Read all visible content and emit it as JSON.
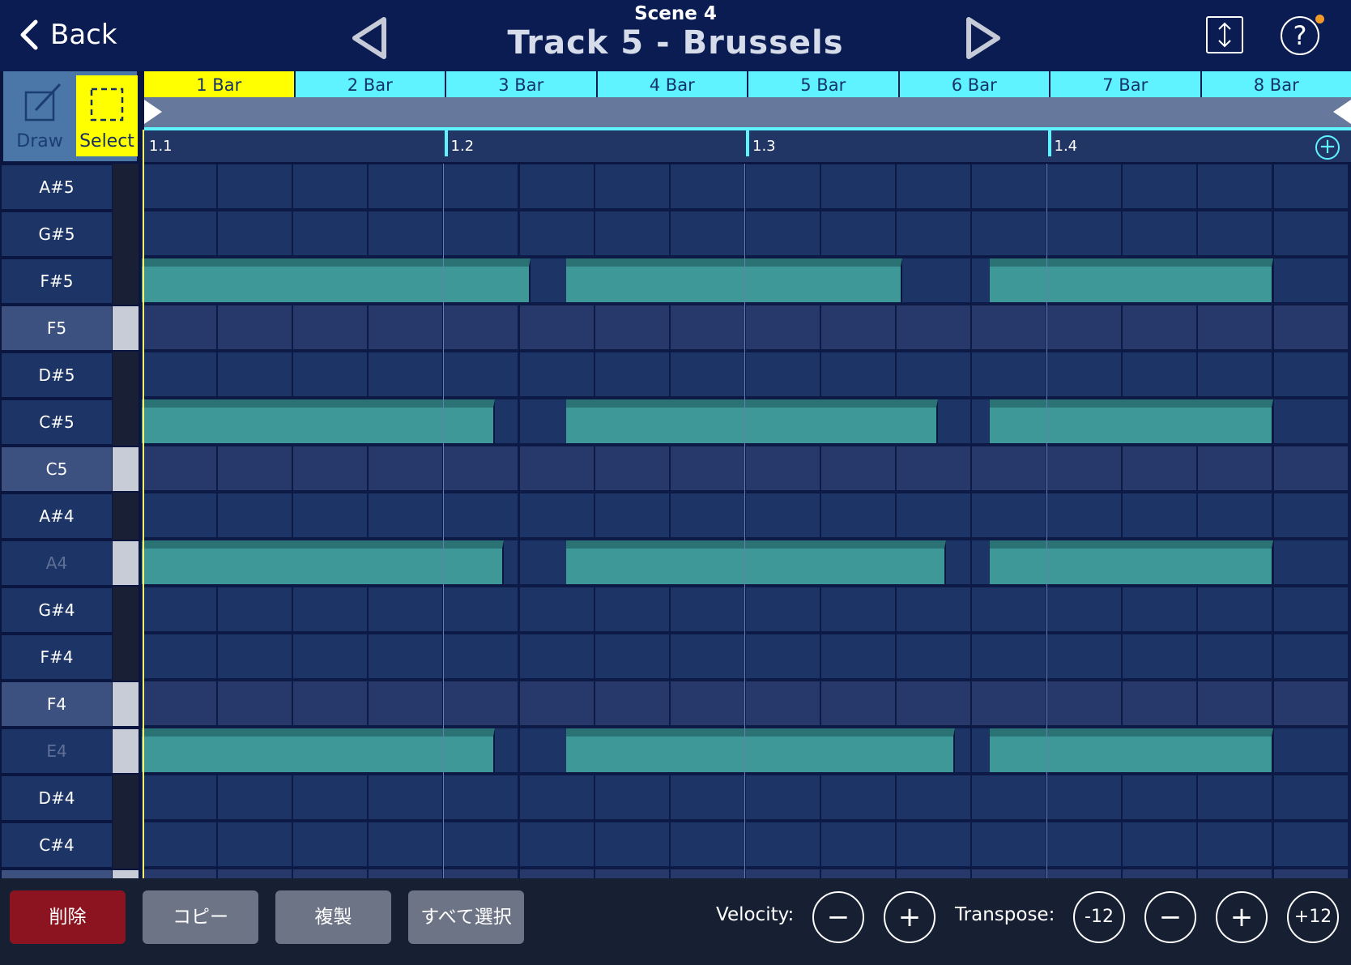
{
  "header": {
    "back_label": "Back",
    "scene": "Scene 4",
    "title": "Track 5 - Brussels",
    "help_label": "?"
  },
  "tools": {
    "draw_label": "Draw",
    "select_label": "Select",
    "active": "Select"
  },
  "bars": [
    "1 Bar",
    "2 Bar",
    "3 Bar",
    "4 Bar",
    "5 Bar",
    "6 Bar",
    "7 Bar",
    "8 Bar"
  ],
  "active_bar": "1 Bar",
  "beats": [
    "1.1",
    "1.2",
    "1.3",
    "1.4"
  ],
  "add_bar_label": "+",
  "keys": [
    {
      "label": "A#5",
      "white": false
    },
    {
      "label": "G#5",
      "white": false
    },
    {
      "label": "F#5",
      "white": false
    },
    {
      "label": "F5",
      "white": true
    },
    {
      "label": "D#5",
      "white": false
    },
    {
      "label": "C#5",
      "white": false
    },
    {
      "label": "C5",
      "white": true
    },
    {
      "label": "A#4",
      "white": false
    },
    {
      "label": "A4",
      "white": true,
      "dim": true
    },
    {
      "label": "G#4",
      "white": false
    },
    {
      "label": "F#4",
      "white": false
    },
    {
      "label": "F4",
      "white": true
    },
    {
      "label": "E4",
      "white": true,
      "dim": true
    },
    {
      "label": "D#4",
      "white": false
    },
    {
      "label": "C#4",
      "white": false
    },
    {
      "label": "",
      "white": true
    }
  ],
  "notes_in_beat_steps": {
    "steps_per_beat": 4,
    "F#5": [
      [
        0,
        2.75
      ],
      [
        3,
        2.38
      ],
      [
        6,
        2.0
      ]
    ],
    "C#5": [
      [
        0,
        2.5
      ],
      [
        3,
        2.63
      ],
      [
        6,
        2.0
      ]
    ],
    "A4": [
      [
        0,
        2.56
      ],
      [
        3,
        2.69
      ],
      [
        6,
        2.0
      ]
    ],
    "E4": [
      [
        0,
        2.5
      ],
      [
        3,
        2.75
      ],
      [
        6,
        2.0
      ]
    ]
  },
  "toolbar": {
    "delete_label": "削除",
    "copy_label": "コピー",
    "duplicate_label": "複製",
    "select_all_label": "すべて選択",
    "velocity_label": "Velocity:",
    "velocity_minus": "−",
    "velocity_plus": "+",
    "transpose_label": "Transpose:",
    "transpose_down_octave": "-12",
    "transpose_minus": "−",
    "transpose_plus": "+",
    "transpose_up_octave": "+12"
  },
  "colors": {
    "header_bg": "#0a1c52",
    "grid_cell": "#1d3566",
    "grid_cell_light": "#26396a",
    "note": "#3e9898",
    "ruler_cyan": "#5ef3ff",
    "active_yellow": "#ffff00",
    "delete_red": "#8c1420"
  }
}
